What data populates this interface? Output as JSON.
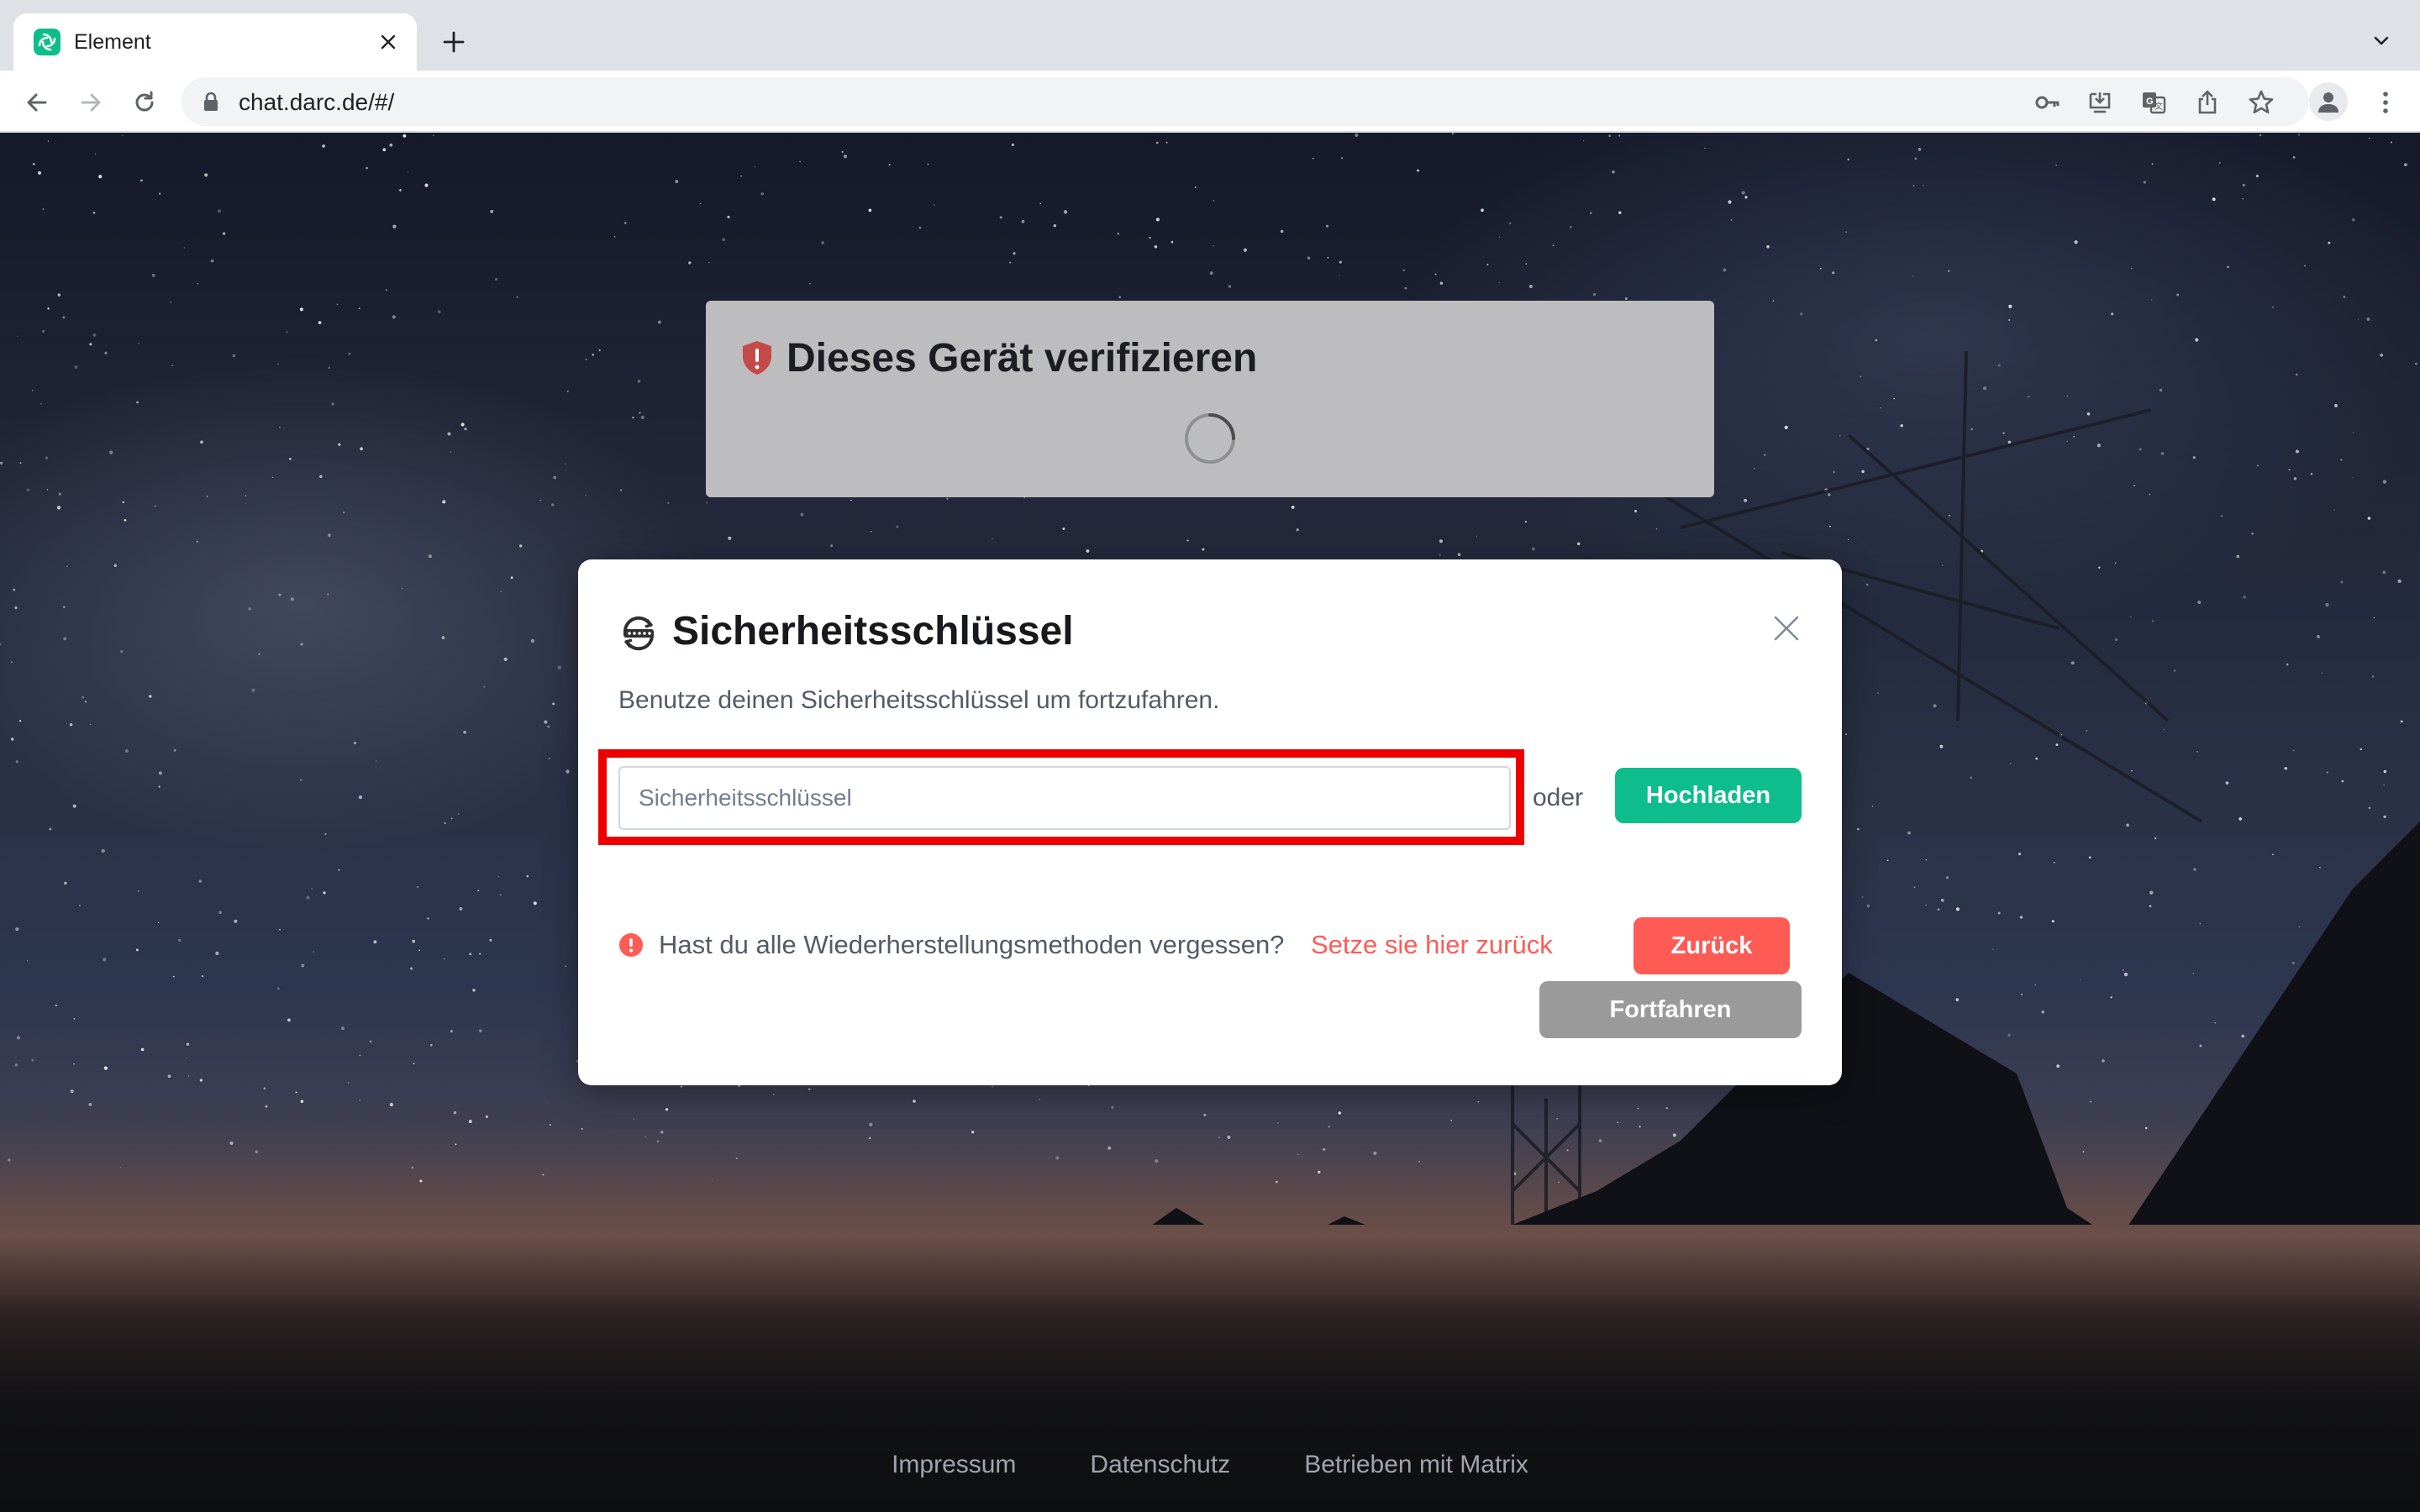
{
  "browser": {
    "tab_title": "Element",
    "url": "chat.darc.de/#/"
  },
  "verify_panel": {
    "title": "Dieses Gerät verifizieren"
  },
  "dialog": {
    "title": "Sicherheitsschlüssel",
    "description": "Benutze deinen Sicherheitsschlüssel um fortzufahren.",
    "input_placeholder": "Sicherheitsschlüssel",
    "input_value": "",
    "or_label": "oder",
    "upload_label": "Hochladen",
    "forgot_text": "Hast du alle Wiederherstellungsmethoden vergessen?",
    "reset_link": "Setze sie hier zurück",
    "back_label": "Zurück",
    "continue_label": "Fortfahren"
  },
  "footer": {
    "links": [
      "Impressum",
      "Datenschutz",
      "Betrieben mit Matrix"
    ]
  },
  "colors": {
    "accent": "#0dbd8b",
    "danger": "#ff5b55",
    "highlight": "#ee0000",
    "disabled": "#9a9a9a"
  },
  "icons": [
    "element-logo-icon",
    "close-icon",
    "plus-icon",
    "chevron-down-icon",
    "back-arrow-icon",
    "forward-arrow-icon",
    "reload-icon",
    "lock-icon",
    "key-icon",
    "install-icon",
    "translate-icon",
    "share-icon",
    "star-icon",
    "profile-icon",
    "kebab-menu-icon",
    "shield-warning-icon",
    "spinner-icon",
    "secure-backup-icon",
    "warning-icon"
  ]
}
